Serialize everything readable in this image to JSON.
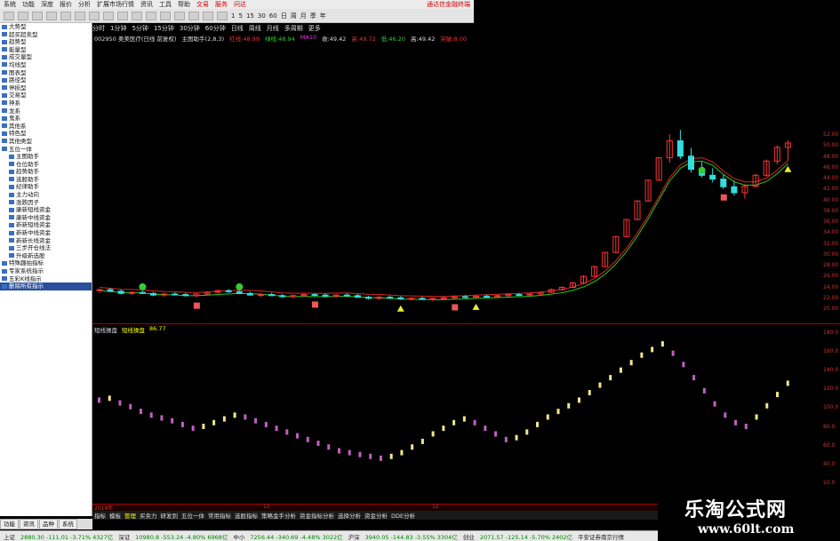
{
  "menu": {
    "items": [
      "系统",
      "功能",
      "深度",
      "报价",
      "分析",
      "扩展市场行情",
      "资讯",
      "工具",
      "帮助"
    ],
    "trade_items": [
      "交易",
      "服务",
      "问达"
    ],
    "right_label": "通达信金融终端"
  },
  "toolbar": {
    "periods": [
      "1",
      "5",
      "15",
      "30",
      "60",
      "日",
      "周",
      "月",
      "季",
      "年"
    ]
  },
  "sidebar": {
    "items": [
      {
        "label": "大势型",
        "level": "top"
      },
      {
        "label": "超买超卖型",
        "level": "top"
      },
      {
        "label": "趋势型",
        "level": "top"
      },
      {
        "label": "能量型",
        "level": "top"
      },
      {
        "label": "成交量型",
        "level": "top"
      },
      {
        "label": "均线型",
        "level": "top"
      },
      {
        "label": "图表型",
        "level": "top"
      },
      {
        "label": "路径型",
        "level": "top"
      },
      {
        "label": "停损型",
        "level": "top"
      },
      {
        "label": "交易型",
        "level": "top"
      },
      {
        "label": "神系",
        "level": "top"
      },
      {
        "label": "龙系",
        "level": "top"
      },
      {
        "label": "鬼系",
        "level": "top"
      },
      {
        "label": "其他系",
        "level": "top"
      },
      {
        "label": "特色型",
        "level": "top"
      },
      {
        "label": "其他类型",
        "level": "top"
      },
      {
        "label": "五位一体",
        "level": "top"
      },
      {
        "label": "主图助手",
        "level": "sub"
      },
      {
        "label": "仓位助手",
        "level": "sub"
      },
      {
        "label": "趋势助手",
        "level": "sub"
      },
      {
        "label": "选股助手",
        "level": "sub"
      },
      {
        "label": "纪律助手",
        "level": "sub"
      },
      {
        "label": "主力动向",
        "level": "sub"
      },
      {
        "label": "涨跌因子",
        "level": "sub"
      },
      {
        "label": "康新短线资金",
        "level": "sub"
      },
      {
        "label": "康新中线资金",
        "level": "sub"
      },
      {
        "label": "新新短线资金",
        "level": "sub"
      },
      {
        "label": "新新中线资金",
        "level": "sub"
      },
      {
        "label": "新新长线资金",
        "level": "sub"
      },
      {
        "label": "三步开仓线法",
        "level": "sub"
      },
      {
        "label": "升级新选股",
        "level": "sub"
      },
      {
        "label": "特殊趣拍指标",
        "level": "top"
      },
      {
        "label": "专家系统指示",
        "level": "top"
      },
      {
        "label": "五彩K线指示",
        "level": "top"
      },
      {
        "label": "删除所有指示",
        "level": "top",
        "selected": true
      }
    ]
  },
  "chart_tabs": [
    "分时",
    "1分钟",
    "5分钟",
    "15分钟",
    "30分钟",
    "60分钟",
    "日线",
    "周线",
    "月线",
    "多周期",
    "更多"
  ],
  "stock": {
    "code_name": "002950 奥美医疗(日线 前复权)",
    "indicator": "主图助手(2,8,3)",
    "readouts": [
      {
        "label": "红线",
        "value": "48.99",
        "color": "#e33"
      },
      {
        "label": "绿线",
        "value": "48.94",
        "color": "#3c3"
      },
      {
        "label": "MA10",
        "value": "",
        "color": "#e3e"
      },
      {
        "label": "收",
        "value": "49.42",
        "color": "#ddd"
      },
      {
        "label": "高",
        "value": "49.72",
        "color": "#e33"
      },
      {
        "label": "低",
        "value": "46.20",
        "color": "#3c3"
      },
      {
        "label": "高",
        "value": "49.42",
        "color": "#ddd"
      },
      {
        "label": "突破",
        "value": "8.00",
        "color": "#e33"
      }
    ]
  },
  "indicator_panel": {
    "name": "短线操盘",
    "subname": "短线操盘",
    "value": "86.77"
  },
  "price_axis": [
    "52.00",
    "50.00",
    "48.00",
    "46.00",
    "44.00",
    "42.00",
    "40.00",
    "38.00",
    "36.00",
    "34.00",
    "32.00",
    "30.00",
    "28.00",
    "26.00",
    "24.00",
    "22.00",
    "20.00"
  ],
  "ind_axis": [
    "180.0",
    "160.0",
    "140.0",
    "120.0",
    "100.0",
    "80.0",
    "60.0",
    "40.0",
    "20.0"
  ],
  "date_scale": [
    "2019年",
    "11",
    "12"
  ],
  "bottom_tabs": [
    "指标",
    "模板",
    "管理",
    "买卖力",
    "研发到",
    "五位一体",
    "常用指标",
    "选股指标",
    "策略金手分析",
    "资金指标分析",
    "选择分析",
    "资金分析",
    "DDE分析"
  ],
  "left_tabs": [
    "功能",
    "资讯",
    "品种",
    "系统"
  ],
  "status": [
    {
      "label": "上证",
      "text": "2880.30 -111.01 -3.71% 4327亿",
      "dn": true
    },
    {
      "label": "深证",
      "text": "10980.8 -553.24 -4.80% 6968亿",
      "dn": true
    },
    {
      "label": "中小",
      "text": "7256.44 -340.69 -4.48% 3022亿",
      "dn": true
    },
    {
      "label": "沪深",
      "text": "3940.05 -144.83 -3.55% 3304亿",
      "dn": true
    },
    {
      "label": "创业",
      "text": "2071.57 -125.14 -5.70% 2402亿",
      "dn": true
    },
    {
      "label": "",
      "text": "平安证券南京行情",
      "dn": false
    }
  ],
  "watermark": {
    "title": "乐淘公式网",
    "url": "www.60lt.com"
  },
  "chart_data": {
    "type": "candlestick",
    "candles": [
      [
        22.4,
        22.8,
        22.0,
        22.6
      ],
      [
        22.6,
        22.9,
        22.1,
        22.3
      ],
      [
        22.3,
        22.6,
        21.7,
        21.9
      ],
      [
        21.9,
        22.3,
        21.6,
        22.1
      ],
      [
        22.1,
        22.4,
        21.8,
        21.9
      ],
      [
        21.9,
        22.2,
        21.4,
        21.6
      ],
      [
        21.6,
        22.0,
        21.3,
        21.8
      ],
      [
        21.8,
        22.1,
        21.5,
        21.7
      ],
      [
        21.7,
        22.0,
        21.3,
        21.5
      ],
      [
        21.5,
        21.9,
        21.2,
        21.8
      ],
      [
        21.8,
        22.3,
        21.6,
        22.1
      ],
      [
        22.1,
        22.6,
        21.9,
        22.4
      ],
      [
        22.4,
        22.7,
        22.0,
        22.2
      ],
      [
        22.2,
        22.5,
        21.8,
        21.9
      ],
      [
        21.9,
        22.2,
        21.5,
        21.6
      ],
      [
        21.6,
        21.9,
        21.3,
        21.7
      ],
      [
        21.7,
        22.0,
        21.4,
        21.5
      ],
      [
        21.5,
        21.8,
        21.1,
        21.3
      ],
      [
        21.3,
        21.7,
        21.0,
        21.5
      ],
      [
        21.5,
        21.9,
        21.3,
        21.7
      ],
      [
        21.7,
        22.0,
        21.4,
        21.6
      ],
      [
        21.6,
        21.9,
        21.2,
        21.4
      ],
      [
        21.4,
        21.8,
        21.1,
        21.6
      ],
      [
        21.6,
        21.9,
        21.3,
        21.5
      ],
      [
        21.5,
        21.8,
        21.1,
        21.2
      ],
      [
        21.2,
        21.5,
        20.8,
        21.0
      ],
      [
        21.0,
        21.4,
        20.7,
        21.2
      ],
      [
        21.2,
        21.5,
        20.9,
        21.1
      ],
      [
        21.1,
        21.4,
        20.7,
        20.9
      ],
      [
        20.9,
        21.2,
        20.6,
        21.0
      ],
      [
        21.0,
        21.3,
        20.7,
        20.8
      ],
      [
        20.8,
        21.2,
        20.5,
        21.0
      ],
      [
        21.0,
        21.3,
        20.7,
        21.1
      ],
      [
        21.1,
        21.5,
        20.9,
        21.3
      ],
      [
        21.3,
        21.6,
        21.0,
        21.2
      ],
      [
        21.2,
        21.6,
        21.0,
        21.4
      ],
      [
        21.4,
        21.7,
        21.1,
        21.3
      ],
      [
        21.3,
        21.7,
        21.1,
        21.5
      ],
      [
        21.5,
        21.9,
        21.3,
        21.7
      ],
      [
        21.7,
        22.0,
        21.4,
        21.6
      ],
      [
        21.6,
        22.0,
        21.4,
        21.8
      ],
      [
        21.8,
        22.3,
        21.6,
        22.1
      ],
      [
        22.1,
        22.8,
        22.0,
        22.6
      ],
      [
        22.6,
        23.2,
        22.4,
        23.0
      ],
      [
        23.0,
        24.0,
        22.9,
        23.8
      ],
      [
        23.8,
        25.2,
        23.6,
        25.0
      ],
      [
        25.0,
        27.0,
        24.9,
        26.8
      ],
      [
        26.8,
        29.5,
        26.7,
        29.4
      ],
      [
        29.4,
        32.4,
        29.3,
        32.3
      ],
      [
        32.3,
        35.5,
        32.2,
        35.4
      ],
      [
        35.4,
        38.9,
        35.3,
        38.8
      ],
      [
        38.8,
        42.7,
        38.7,
        42.6
      ],
      [
        42.6,
        46.8,
        42.5,
        46.7
      ],
      [
        46.7,
        51.0,
        45.8,
        49.8
      ],
      [
        49.8,
        51.8,
        46.5,
        47.0
      ],
      [
        47.0,
        48.5,
        44.0,
        44.6
      ],
      [
        44.6,
        46.0,
        43.1,
        43.5
      ],
      [
        43.5,
        44.8,
        42.2,
        42.8
      ],
      [
        42.8,
        43.6,
        41.0,
        41.4
      ],
      [
        41.4,
        42.5,
        39.8,
        40.3
      ],
      [
        40.3,
        41.9,
        39.2,
        41.5
      ],
      [
        41.5,
        43.8,
        41.2,
        43.5
      ],
      [
        43.5,
        46.4,
        43.2,
        46.1
      ],
      [
        46.1,
        49.0,
        45.5,
        48.6
      ],
      [
        48.6,
        49.9,
        46.2,
        49.4
      ]
    ],
    "indicator": [
      100,
      102,
      97,
      93,
      88,
      84,
      81,
      78,
      74,
      70,
      72,
      76,
      80,
      84,
      82,
      78,
      74,
      70,
      66,
      62,
      58,
      54,
      50,
      46,
      44,
      42,
      40,
      38,
      40,
      44,
      50,
      56,
      64,
      70,
      76,
      80,
      76,
      70,
      64,
      58,
      60,
      66,
      74,
      82,
      88,
      94,
      100,
      108,
      116,
      124,
      132,
      140,
      148,
      154,
      160,
      150,
      138,
      124,
      110,
      96,
      84,
      76,
      72,
      82,
      94,
      106,
      118
    ],
    "ylim": [
      20,
      52
    ],
    "ind_ylim": [
      0,
      180
    ]
  }
}
